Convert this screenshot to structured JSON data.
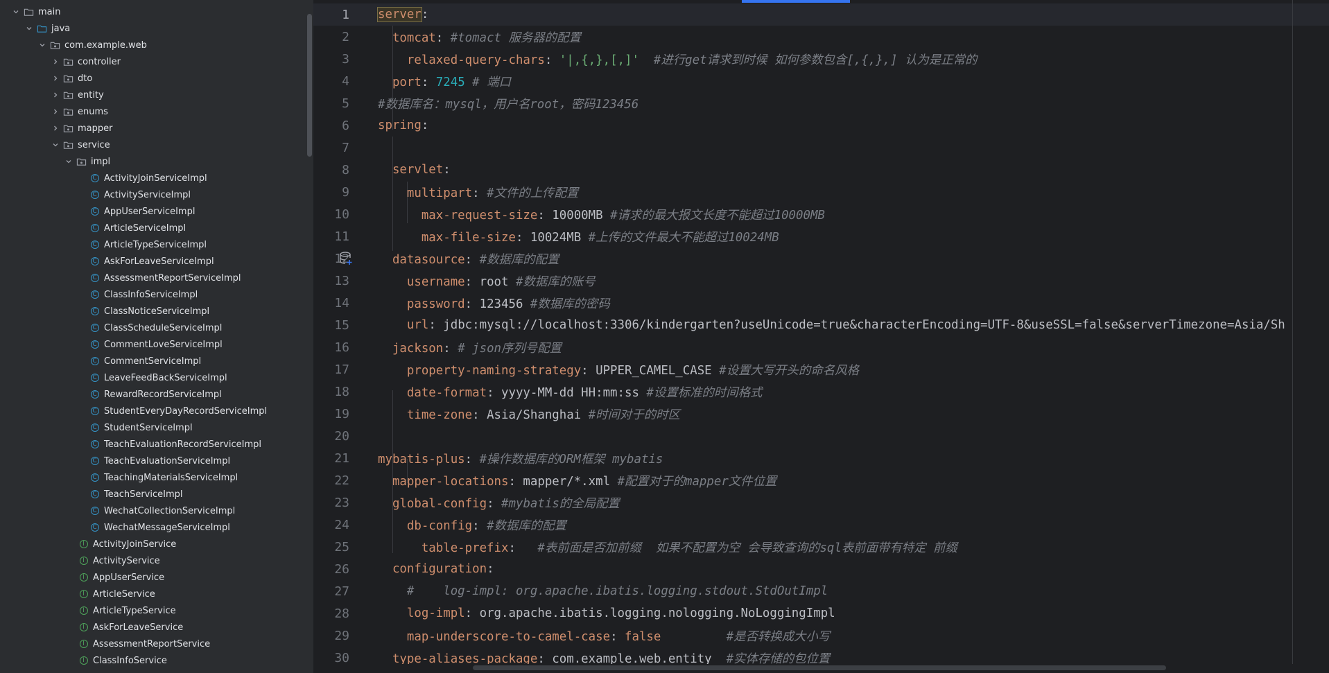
{
  "tree": {
    "rows": [
      {
        "label": "main",
        "kind": "folder",
        "chevron": "down"
      },
      {
        "label": "java",
        "kind": "folder-src",
        "chevron": "down"
      },
      {
        "label": "com.example.web",
        "kind": "package",
        "chevron": "down"
      },
      {
        "label": "controller",
        "kind": "package",
        "chevron": "right"
      },
      {
        "label": "dto",
        "kind": "package",
        "chevron": "right"
      },
      {
        "label": "entity",
        "kind": "package",
        "chevron": "right"
      },
      {
        "label": "enums",
        "kind": "package",
        "chevron": "right"
      },
      {
        "label": "mapper",
        "kind": "package",
        "chevron": "right"
      },
      {
        "label": "service",
        "kind": "package",
        "chevron": "down"
      },
      {
        "label": "impl",
        "kind": "package",
        "chevron": "down"
      },
      {
        "label": "ActivityJoinServiceImpl",
        "kind": "class",
        "chevron": ""
      },
      {
        "label": "ActivityServiceImpl",
        "kind": "class",
        "chevron": ""
      },
      {
        "label": "AppUserServiceImpl",
        "kind": "class",
        "chevron": ""
      },
      {
        "label": "ArticleServiceImpl",
        "kind": "class",
        "chevron": ""
      },
      {
        "label": "ArticleTypeServiceImpl",
        "kind": "class",
        "chevron": ""
      },
      {
        "label": "AskForLeaveServiceImpl",
        "kind": "class",
        "chevron": ""
      },
      {
        "label": "AssessmentReportServiceImpl",
        "kind": "class",
        "chevron": ""
      },
      {
        "label": "ClassInfoServiceImpl",
        "kind": "class",
        "chevron": ""
      },
      {
        "label": "ClassNoticeServiceImpl",
        "kind": "class",
        "chevron": ""
      },
      {
        "label": "ClassScheduleServiceImpl",
        "kind": "class",
        "chevron": ""
      },
      {
        "label": "CommentLoveServiceImpl",
        "kind": "class",
        "chevron": ""
      },
      {
        "label": "CommentServiceImpl",
        "kind": "class",
        "chevron": ""
      },
      {
        "label": "LeaveFeedBackServiceImpl",
        "kind": "class",
        "chevron": ""
      },
      {
        "label": "RewardRecordServiceImpl",
        "kind": "class",
        "chevron": ""
      },
      {
        "label": "StudentEveryDayRecordServiceImpl",
        "kind": "class",
        "chevron": ""
      },
      {
        "label": "StudentServiceImpl",
        "kind": "class",
        "chevron": ""
      },
      {
        "label": "TeachEvaluationRecordServiceImpl",
        "kind": "class",
        "chevron": ""
      },
      {
        "label": "TeachEvaluationServiceImpl",
        "kind": "class",
        "chevron": ""
      },
      {
        "label": "TeachingMaterialsServiceImpl",
        "kind": "class",
        "chevron": ""
      },
      {
        "label": "TeachServiceImpl",
        "kind": "class",
        "chevron": ""
      },
      {
        "label": "WechatCollectionServiceImpl",
        "kind": "class",
        "chevron": ""
      },
      {
        "label": "WechatMessageServiceImpl",
        "kind": "class",
        "chevron": ""
      },
      {
        "label": "ActivityJoinService",
        "kind": "interface",
        "chevron": ""
      },
      {
        "label": "ActivityService",
        "kind": "interface",
        "chevron": ""
      },
      {
        "label": "AppUserService",
        "kind": "interface",
        "chevron": ""
      },
      {
        "label": "ArticleService",
        "kind": "interface",
        "chevron": ""
      },
      {
        "label": "ArticleTypeService",
        "kind": "interface",
        "chevron": ""
      },
      {
        "label": "AskForLeaveService",
        "kind": "interface",
        "chevron": ""
      },
      {
        "label": "AssessmentReportService",
        "kind": "interface",
        "chevron": ""
      },
      {
        "label": "ClassInfoService",
        "kind": "interface",
        "chevron": ""
      }
    ]
  },
  "editor": {
    "lines": [
      {
        "n": "1",
        "tokens": [
          {
            "t": "k",
            "v": "server",
            "box": true
          },
          {
            "t": "p",
            "v": ":"
          }
        ]
      },
      {
        "n": "2",
        "tokens": [
          {
            "t": "p",
            "v": "  "
          },
          {
            "t": "k",
            "v": "tomcat"
          },
          {
            "t": "p",
            "v": ": "
          },
          {
            "t": "c",
            "v": "#tomact 服务器的配置"
          }
        ]
      },
      {
        "n": "3",
        "tokens": [
          {
            "t": "p",
            "v": "    "
          },
          {
            "t": "k",
            "v": "relaxed-query-chars"
          },
          {
            "t": "p",
            "v": ": "
          },
          {
            "t": "s",
            "v": "'|,{,},[,]'"
          },
          {
            "t": "p",
            "v": "  "
          },
          {
            "t": "c",
            "v": "#进行get请求到时候 如何参数包含[,{,},] 认为是正常的"
          }
        ]
      },
      {
        "n": "4",
        "tokens": [
          {
            "t": "p",
            "v": "  "
          },
          {
            "t": "k",
            "v": "port"
          },
          {
            "t": "p",
            "v": ": "
          },
          {
            "t": "n",
            "v": "7245"
          },
          {
            "t": "p",
            "v": " "
          },
          {
            "t": "c",
            "v": "# 端口"
          }
        ]
      },
      {
        "n": "5",
        "tokens": [
          {
            "t": "c",
            "v": "#数据库名：mysql，用户名root，密码123456"
          }
        ]
      },
      {
        "n": "6",
        "tokens": [
          {
            "t": "k",
            "v": "spring"
          },
          {
            "t": "p",
            "v": ":"
          }
        ]
      },
      {
        "n": "7",
        "tokens": []
      },
      {
        "n": "8",
        "tokens": [
          {
            "t": "p",
            "v": "  "
          },
          {
            "t": "k",
            "v": "servlet"
          },
          {
            "t": "p",
            "v": ":"
          }
        ]
      },
      {
        "n": "9",
        "tokens": [
          {
            "t": "p",
            "v": "    "
          },
          {
            "t": "k",
            "v": "multipart"
          },
          {
            "t": "p",
            "v": ": "
          },
          {
            "t": "c",
            "v": "#文件的上传配置"
          }
        ]
      },
      {
        "n": "10",
        "tokens": [
          {
            "t": "p",
            "v": "      "
          },
          {
            "t": "k",
            "v": "max-request-size"
          },
          {
            "t": "p",
            "v": ": 10000MB "
          },
          {
            "t": "c",
            "v": "#请求的最大报文长度不能超过10000MB"
          }
        ]
      },
      {
        "n": "11",
        "tokens": [
          {
            "t": "p",
            "v": "      "
          },
          {
            "t": "k",
            "v": "max-file-size"
          },
          {
            "t": "p",
            "v": ": 10024MB "
          },
          {
            "t": "c",
            "v": "#上传的文件最大不能超过10024MB"
          }
        ]
      },
      {
        "n": "12",
        "tokens": [
          {
            "t": "p",
            "v": "  "
          },
          {
            "t": "k",
            "v": "datasource"
          },
          {
            "t": "p",
            "v": ": "
          },
          {
            "t": "c",
            "v": "#数据库的配置"
          }
        ]
      },
      {
        "n": "13",
        "tokens": [
          {
            "t": "p",
            "v": "    "
          },
          {
            "t": "k",
            "v": "username"
          },
          {
            "t": "p",
            "v": ": root "
          },
          {
            "t": "c",
            "v": "#数据库的账号"
          }
        ]
      },
      {
        "n": "14",
        "tokens": [
          {
            "t": "p",
            "v": "    "
          },
          {
            "t": "k",
            "v": "password"
          },
          {
            "t": "p",
            "v": ": 123456 "
          },
          {
            "t": "c",
            "v": "#数据库的密码"
          }
        ]
      },
      {
        "n": "15",
        "tokens": [
          {
            "t": "p",
            "v": "    "
          },
          {
            "t": "k",
            "v": "url"
          },
          {
            "t": "p",
            "v": ": jdbc:mysql://localhost:3306/kindergarten?useUnicode=true&characterEncoding=UTF-8&useSSL=false&serverTimezone=Asia/Sh"
          }
        ]
      },
      {
        "n": "16",
        "tokens": [
          {
            "t": "p",
            "v": "  "
          },
          {
            "t": "k",
            "v": "jackson"
          },
          {
            "t": "p",
            "v": ": "
          },
          {
            "t": "c",
            "v": "# json序列号配置"
          }
        ]
      },
      {
        "n": "17",
        "tokens": [
          {
            "t": "p",
            "v": "    "
          },
          {
            "t": "k",
            "v": "property-naming-strategy"
          },
          {
            "t": "p",
            "v": ": UPPER_CAMEL_CASE "
          },
          {
            "t": "c",
            "v": "#设置大写开头的命名风格"
          }
        ]
      },
      {
        "n": "18",
        "tokens": [
          {
            "t": "p",
            "v": "    "
          },
          {
            "t": "k",
            "v": "date-format"
          },
          {
            "t": "p",
            "v": ": yyyy-MM-dd HH:mm:ss "
          },
          {
            "t": "c",
            "v": "#设置标准的时间格式"
          }
        ]
      },
      {
        "n": "19",
        "tokens": [
          {
            "t": "p",
            "v": "    "
          },
          {
            "t": "k",
            "v": "time-zone"
          },
          {
            "t": "p",
            "v": ": Asia/Shanghai "
          },
          {
            "t": "c",
            "v": "#时间对于的时区"
          }
        ]
      },
      {
        "n": "20",
        "tokens": []
      },
      {
        "n": "21",
        "tokens": [
          {
            "t": "k",
            "v": "mybatis-plus"
          },
          {
            "t": "p",
            "v": ": "
          },
          {
            "t": "c",
            "v": "#操作数据库的ORM框架 mybatis"
          }
        ]
      },
      {
        "n": "22",
        "tokens": [
          {
            "t": "p",
            "v": "  "
          },
          {
            "t": "k",
            "v": "mapper-locations"
          },
          {
            "t": "p",
            "v": ": mapper/*.xml "
          },
          {
            "t": "c",
            "v": "#配置对于的mapper文件位置"
          }
        ]
      },
      {
        "n": "23",
        "tokens": [
          {
            "t": "p",
            "v": "  "
          },
          {
            "t": "k",
            "v": "global-config"
          },
          {
            "t": "p",
            "v": ": "
          },
          {
            "t": "c",
            "v": "#mybatis的全局配置"
          }
        ]
      },
      {
        "n": "24",
        "tokens": [
          {
            "t": "p",
            "v": "    "
          },
          {
            "t": "k",
            "v": "db-config"
          },
          {
            "t": "p",
            "v": ": "
          },
          {
            "t": "c",
            "v": "#数据库的配置"
          }
        ]
      },
      {
        "n": "25",
        "tokens": [
          {
            "t": "p",
            "v": "      "
          },
          {
            "t": "k",
            "v": "table-prefix"
          },
          {
            "t": "p",
            "v": ":   "
          },
          {
            "t": "c",
            "v": "#表前面是否加前缀  如果不配置为空 会导致查询的sql表前面带有特定 前缀"
          }
        ]
      },
      {
        "n": "26",
        "tokens": [
          {
            "t": "p",
            "v": "  "
          },
          {
            "t": "k",
            "v": "configuration"
          },
          {
            "t": "p",
            "v": ":"
          }
        ]
      },
      {
        "n": "27",
        "tokens": [
          {
            "t": "p",
            "v": "    "
          },
          {
            "t": "c",
            "v": "#    log-impl: org.apache.ibatis.logging.stdout.StdOutImpl"
          }
        ]
      },
      {
        "n": "28",
        "tokens": [
          {
            "t": "p",
            "v": "    "
          },
          {
            "t": "k",
            "v": "log-impl"
          },
          {
            "t": "p",
            "v": ": org.apache.ibatis.logging.nologging.NoLoggingImpl"
          }
        ]
      },
      {
        "n": "29",
        "tokens": [
          {
            "t": "p",
            "v": "    "
          },
          {
            "t": "k",
            "v": "map-underscore-to-camel-case"
          },
          {
            "t": "p",
            "v": ": "
          },
          {
            "t": "k",
            "v": "false"
          },
          {
            "t": "p",
            "v": "         "
          },
          {
            "t": "c",
            "v": "#是否转换成大小写"
          }
        ]
      },
      {
        "n": "30",
        "tokens": [
          {
            "t": "p",
            "v": "  "
          },
          {
            "t": "k",
            "v": "type-aliases-package"
          },
          {
            "t": "p",
            "v": ": com.example.web.entity  "
          },
          {
            "t": "c",
            "v": "#实体存储的包位置"
          }
        ]
      }
    ]
  },
  "gutter_icons": {
    "line12": "database-icon"
  },
  "colors": {
    "keyword": "#cf8e6d",
    "comment": "#7a7e85",
    "number": "#2aacb8",
    "string": "#6aab73",
    "text": "#bcbec4",
    "accent": "#3574f0"
  }
}
